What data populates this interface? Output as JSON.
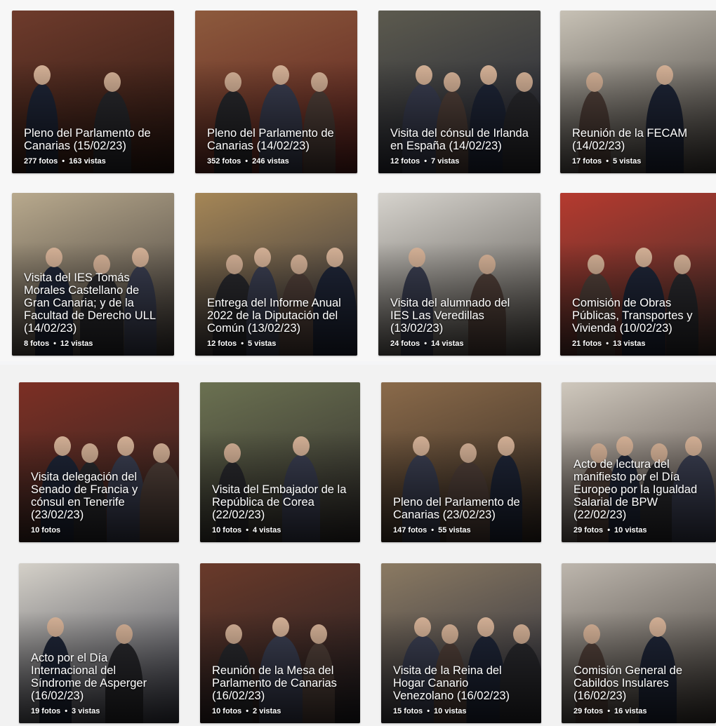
{
  "gallery": {
    "albums": [
      {
        "title": "Pleno del Parlamento de Canarias (15/02/23)",
        "photos": "277 fotos",
        "views": "163 vistas",
        "bg": "#6e3b2c",
        "bg2": "#2b1711"
      },
      {
        "title": "Pleno del Parlamento de Canarias (14/02/23)",
        "photos": "352 fotos",
        "views": "246 vistas",
        "bg": "#8d5a3d",
        "bg2": "#5a1f1d"
      },
      {
        "title": "Visita del cónsul de Irlanda en España (14/02/23)",
        "photos": "12 fotos",
        "views": "7 vistas",
        "bg": "#5c5a4e",
        "bg2": "#1f2233"
      },
      {
        "title": "Reunión de la FECAM (14/02/23)",
        "photos": "17 fotos",
        "views": "5 vistas",
        "bg": "#c7c1b5",
        "bg2": "#3c3835"
      },
      {
        "title": "Visita del IES Tomás Morales Castellano de Gran Canaria; y de la Facultad de Derecho ULL (14/02/23)",
        "photos": "8 fotos",
        "views": "12 vistas",
        "bg": "#b8a98d",
        "bg2": "#3a3533"
      },
      {
        "title": "Entrega del Informe Anual 2022 de la Diputación del Común (13/02/23)",
        "photos": "12 fotos",
        "views": "5 vistas",
        "bg": "#a58656",
        "bg2": "#2b2d3a"
      },
      {
        "title": "Visita del alumnado del IES Las Veredillas (13/02/23)",
        "photos": "24 fotos",
        "views": "14 vistas",
        "bg": "#d6d3cd",
        "bg2": "#4e4a45"
      },
      {
        "title": "Comisión de Obras Públicas, Transportes y Vivienda (10/02/23)",
        "photos": "21 fotos",
        "views": "13 vistas",
        "bg": "#b53a2f",
        "bg2": "#3b2e2a"
      },
      {
        "title": "Visita delegación del Senado de Francia y cónsul en Tenerife (23/02/23)",
        "photos": "10 fotos",
        "views": "",
        "bg": "#7c2f24",
        "bg2": "#2c2623"
      },
      {
        "title": "Visita del Embajador de la República de Corea (22/02/23)",
        "photos": "10 fotos",
        "views": "4 vistas",
        "bg": "#6b7151",
        "bg2": "#2e2a2a"
      },
      {
        "title": "Pleno del Parlamento de Canarias (23/02/23)",
        "photos": "147 fotos",
        "views": "55 vistas",
        "bg": "#8a6a4a",
        "bg2": "#2f2620"
      },
      {
        "title": "Acto de lectura del manifiesto por el Día Europeo por la Igualdad Salarial de BPW (22/02/23)",
        "photos": "29 fotos",
        "views": "10 vistas",
        "bg": "#cfc8bd",
        "bg2": "#4a403c"
      },
      {
        "title": "Acto por el Día Internacional del Síndrome de Asperger (16/02/23)",
        "photos": "19 fotos",
        "views": "3 vistas",
        "bg": "#d4d0c8",
        "bg2": "#3a3c48"
      },
      {
        "title": "Reunión de la Mesa del Parlamento de Canarias (16/02/23)",
        "photos": "10 fotos",
        "views": "2 vistas",
        "bg": "#6a3a2a",
        "bg2": "#1e1d22"
      },
      {
        "title": "Visita de la Reina del Hogar Canario Venezolano (16/02/23)",
        "photos": "15 fotos",
        "views": "10 vistas",
        "bg": "#8b7a62",
        "bg2": "#262a3a"
      },
      {
        "title": "Comisión General de Cabildos Insulares (16/02/23)",
        "photos": "29 fotos",
        "views": "16 vistas",
        "bg": "#bdb6ad",
        "bg2": "#3a3531"
      }
    ]
  }
}
